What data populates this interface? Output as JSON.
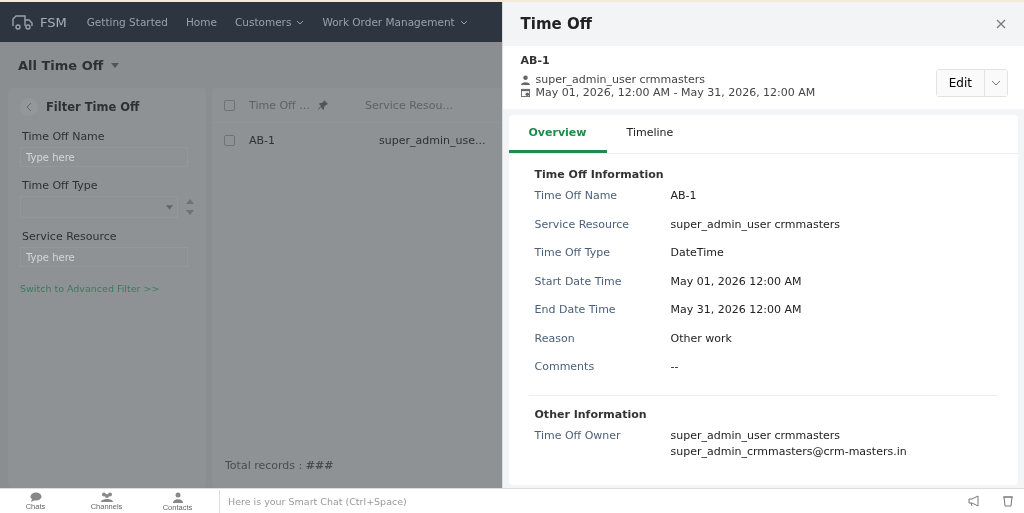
{
  "nav": {
    "brand": "FSM",
    "items": [
      {
        "label": "Getting Started",
        "dropdown": false
      },
      {
        "label": "Home",
        "dropdown": false
      },
      {
        "label": "Customers",
        "dropdown": true
      },
      {
        "label": "Work Order Management",
        "dropdown": true
      }
    ]
  },
  "view_title": "All Time Off",
  "filter": {
    "title": "Filter Time Off",
    "fields": [
      {
        "label": "Time Off Name",
        "kind": "text",
        "placeholder": "Type here"
      },
      {
        "label": "Time Off Type",
        "kind": "select"
      },
      {
        "label": "Service Resource",
        "kind": "text",
        "placeholder": "Type here"
      }
    ],
    "advanced_link": "Switch to Advanced Filter >>"
  },
  "table": {
    "header_checked": false,
    "columns": [
      "Time Off ...",
      "Service Resou..."
    ],
    "rows": [
      {
        "cells": [
          "AB-1",
          "super_admin_use..."
        ],
        "checked": false
      }
    ],
    "footer_label": "Total records :",
    "footer_value": "###"
  },
  "panel": {
    "title": "Time Off",
    "record": "AB-1",
    "owner": "super_admin_user crmmasters",
    "range": "May 01, 2026, 12:00 AM - May 31, 2026, 12:00 AM",
    "edit_button": "Edit",
    "tabs": [
      {
        "label": "Overview",
        "selected": true
      },
      {
        "label": "Timeline",
        "selected": false
      }
    ],
    "sections": [
      {
        "title": "Time Off Information",
        "fields": [
          {
            "label": "Time Off Name",
            "value": "AB-1"
          },
          {
            "label": "Service Resource",
            "value": "super_admin_user crmmasters"
          },
          {
            "label": "Time Off Type",
            "value": "DateTime"
          },
          {
            "label": "Start Date Time",
            "value": "May 01, 2026 12:00 AM"
          },
          {
            "label": "End Date Time",
            "value": "May 31, 2026 12:00 AM"
          },
          {
            "label": "Reason",
            "value": "Other work"
          },
          {
            "label": "Comments",
            "value": "--"
          }
        ]
      },
      {
        "title": "Other Information",
        "fields": [
          {
            "label": "Time Off Owner",
            "value": "super_admin_user crmmasters",
            "value_2": "super_admin_crmmasters@crm-masters.in"
          }
        ]
      }
    ]
  },
  "bottom_bar": {
    "items": [
      {
        "label": "Chats",
        "kind": "chats"
      },
      {
        "label": "Channels",
        "kind": "channels"
      },
      {
        "label": "Contacts",
        "kind": "contacts"
      }
    ],
    "chat_placeholder": "Here is your Smart Chat (Ctrl+Space)"
  }
}
